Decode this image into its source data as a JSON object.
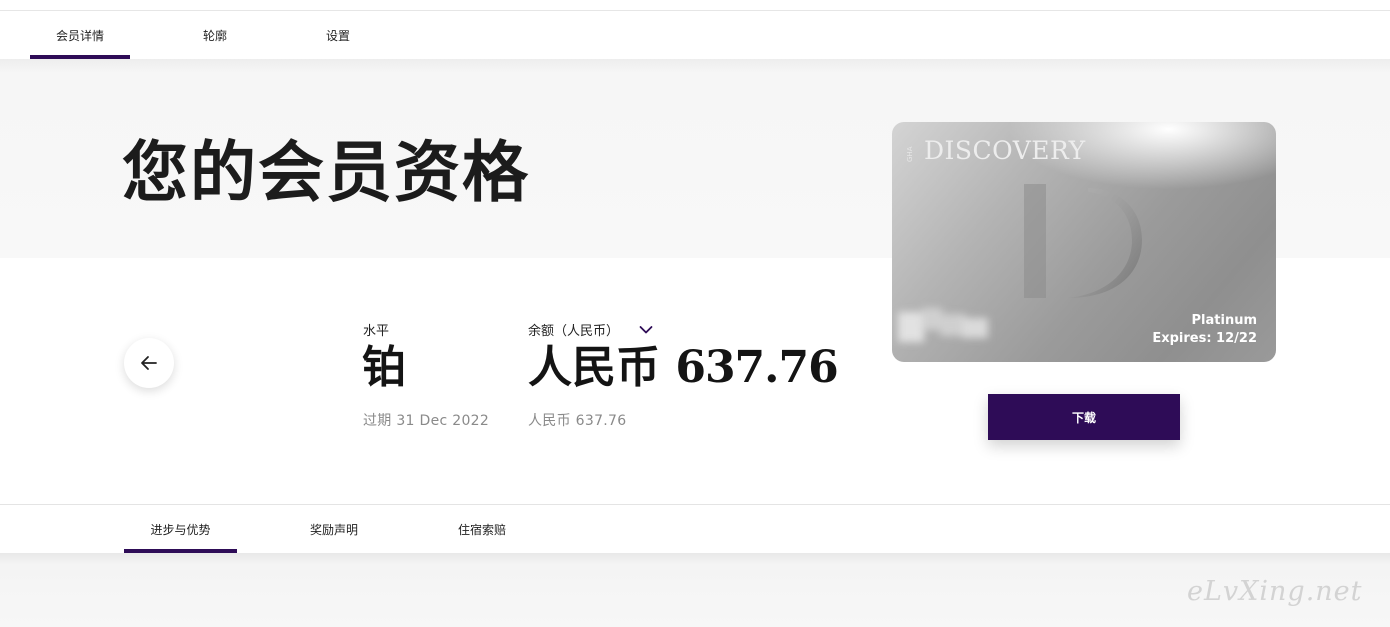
{
  "top_tabs": [
    {
      "label": "会员详情",
      "active": true
    },
    {
      "label": "轮廓",
      "active": false
    },
    {
      "label": "设置",
      "active": false
    }
  ],
  "page_title": "您的会员资格",
  "level": {
    "label": "水平",
    "value": "铂",
    "expiry": "过期 31 Dec 2022"
  },
  "balance": {
    "label": "余额（人民币）",
    "currency": "人民币",
    "amount": "637.76",
    "sub": "人民币 637.76"
  },
  "card": {
    "brand": "DISCOVERY",
    "brand_small": "GHA",
    "tier": "Platinum",
    "expires": "Expires: 12/22"
  },
  "download_label": "下载",
  "bottom_tabs": [
    {
      "label": "进步与优势",
      "active": true
    },
    {
      "label": "奖励声明",
      "active": false
    },
    {
      "label": "住宿索赔",
      "active": false
    }
  ],
  "watermark": "eLvXing.net",
  "colors": {
    "accent": "#2e0c57"
  },
  "icons": {
    "back": "arrow-left-icon",
    "dropdown": "chevron-down-icon"
  }
}
